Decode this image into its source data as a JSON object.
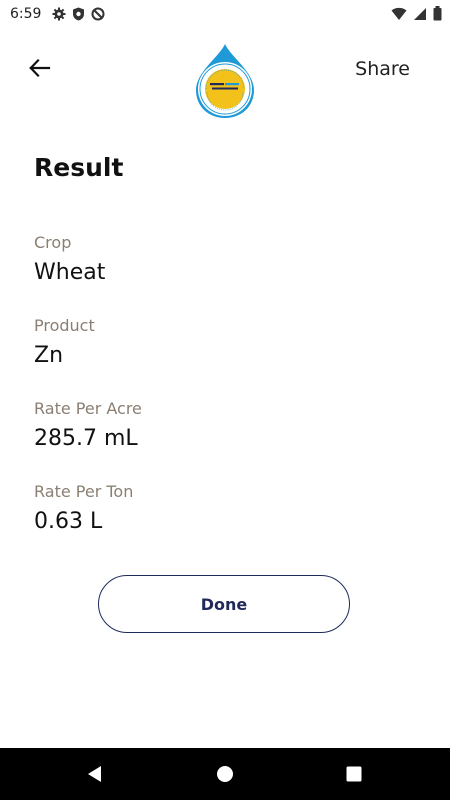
{
  "status_bar": {
    "time": "6:59",
    "left_icons": [
      "gear-icon",
      "shield-icon",
      "no-sync-icon"
    ],
    "right_icons": [
      "wifi-icon",
      "cell-signal-icon",
      "battery-icon"
    ]
  },
  "app_bar": {
    "back_icon": "arrow-left-icon",
    "share_label": "Share"
  },
  "page": {
    "title": "Result"
  },
  "fields": [
    {
      "label": "Crop",
      "value": "Wheat"
    },
    {
      "label": "Product",
      "value": "Zn"
    },
    {
      "label": "Rate Per Acre",
      "value": "285.7 mL"
    },
    {
      "label": "Rate Per Ton",
      "value": "0.63 L"
    }
  ],
  "actions": {
    "done_label": "Done"
  },
  "colors": {
    "accent": "#1f2a5a",
    "label": "#8a7f72",
    "logo_blue": "#1e9ad6",
    "logo_yellow": "#f2c21b"
  }
}
